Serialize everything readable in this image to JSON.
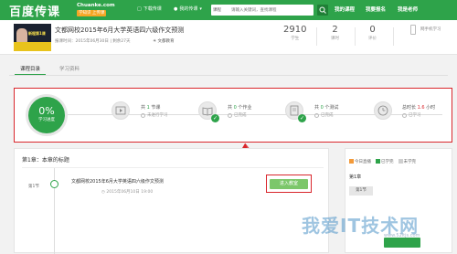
{
  "header": {
    "logo": "百度传课",
    "logo_domain": "Chuanke.com",
    "logo_tag": "学知识 上传课",
    "nav": [
      "下载传课",
      "我的传课"
    ],
    "search_category": "课程",
    "search_placeholder": "请输入关键词，查找课程",
    "links": [
      "我的课程",
      "我要报名",
      "我是老师"
    ]
  },
  "course": {
    "thumb_text": "新程第1课 ",
    "title": "文都网校2015年6月大学英语四六级作文预测",
    "meta": "报课时间：2015年06月30日 | 剩余27天",
    "org": "文都教育",
    "stats": [
      {
        "value": "2910",
        "label": "学生"
      },
      {
        "value": "2",
        "label": "课时"
      },
      {
        "value": "0",
        "label": "评价"
      }
    ],
    "mobile_label": "网手机学习"
  },
  "tabs": [
    "课程目录",
    "学习资料"
  ],
  "progress": {
    "percent": "0%",
    "label": "学习进度",
    "steps": [
      {
        "title_prefix": "共",
        "count": "1",
        "title_suffix": "节课",
        "status": "未进行学习"
      },
      {
        "title_prefix": "共",
        "count": "0",
        "title_suffix": "个作业",
        "status": "已完成"
      },
      {
        "title_prefix": "共",
        "count": "0",
        "title_suffix": "个测试",
        "status": "已完成"
      },
      {
        "title_prefix": "总时长",
        "count": "1.6",
        "title_suffix": "小时",
        "status": "已学习"
      }
    ]
  },
  "chapter": {
    "title": "第1章：本章的标题",
    "lesson_num": "第1节",
    "lesson_title": "文都网校2015年6月大学英语四六级作文预测",
    "lesson_time": "2015年06月10日 19:00",
    "enter_label": "进入教室"
  },
  "sidebar": {
    "legend": [
      "今日直播",
      "已学完",
      "未学完"
    ],
    "legend_colors": [
      "#f39a3a",
      "#2ea34a",
      "#cfcfcf"
    ],
    "chapter": "第1章",
    "lesson_box": "第1节"
  },
  "watermark": {
    "text": "我爱IT技术网",
    "url": "www.52itjs.com"
  }
}
